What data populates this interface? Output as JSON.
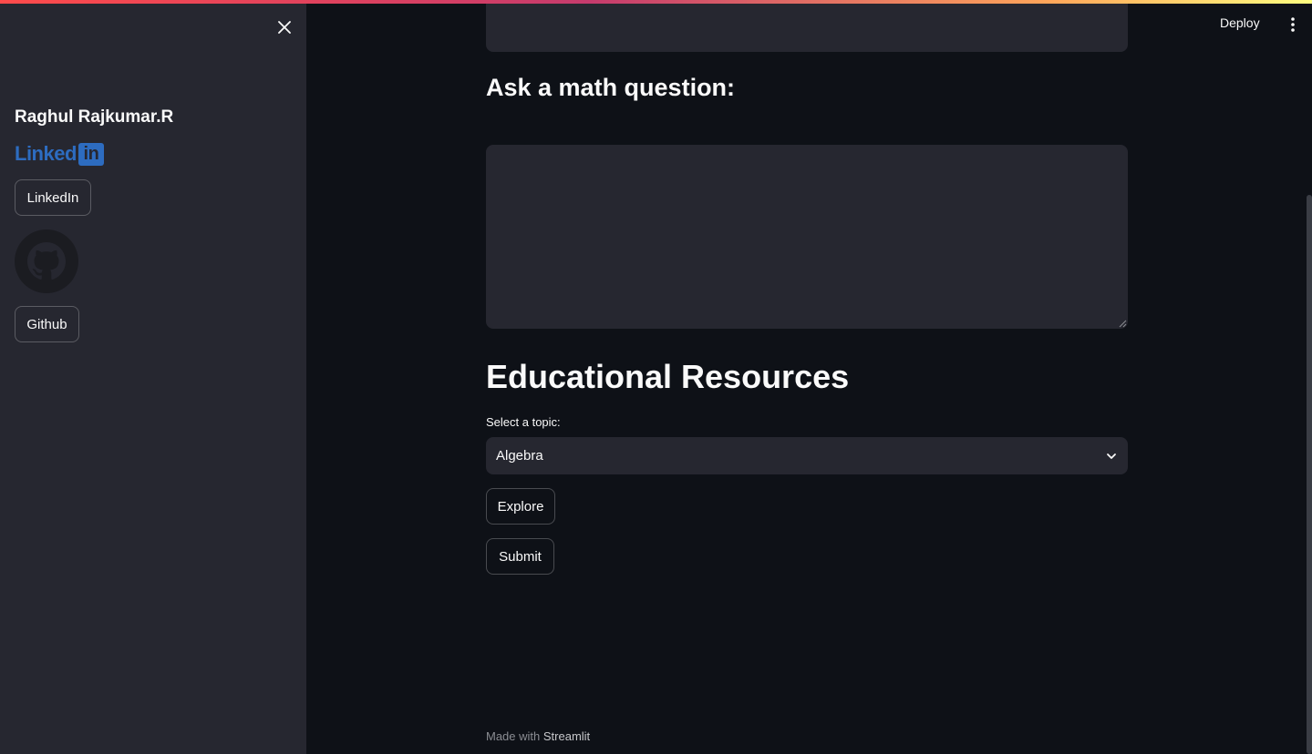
{
  "sidebar": {
    "author_name": "Raghul Rajkumar.R",
    "linkedin_logo": {
      "text": "Linked",
      "box_text": "in",
      "color": "#2d6cc0"
    },
    "linkedin_button": "LinkedIn",
    "github_button": "Github"
  },
  "topbar": {
    "deploy_label": "Deploy"
  },
  "main": {
    "subheader": "Ask a math question:",
    "question_input": {
      "value": "",
      "placeholder": ""
    },
    "header": "Educational Resources",
    "topic_select": {
      "label": "Select a topic:",
      "value": "Algebra"
    },
    "explore_button": "Explore",
    "submit_button": "Submit"
  },
  "footer": {
    "prefix": "Made with",
    "brand": "Streamlit"
  },
  "colors": {
    "background": "#0e1117",
    "sidebar": "#262730",
    "input": "#262730",
    "text": "#fafafa",
    "accent_start": "#ff4b4b",
    "accent_end": "#fffd80"
  }
}
